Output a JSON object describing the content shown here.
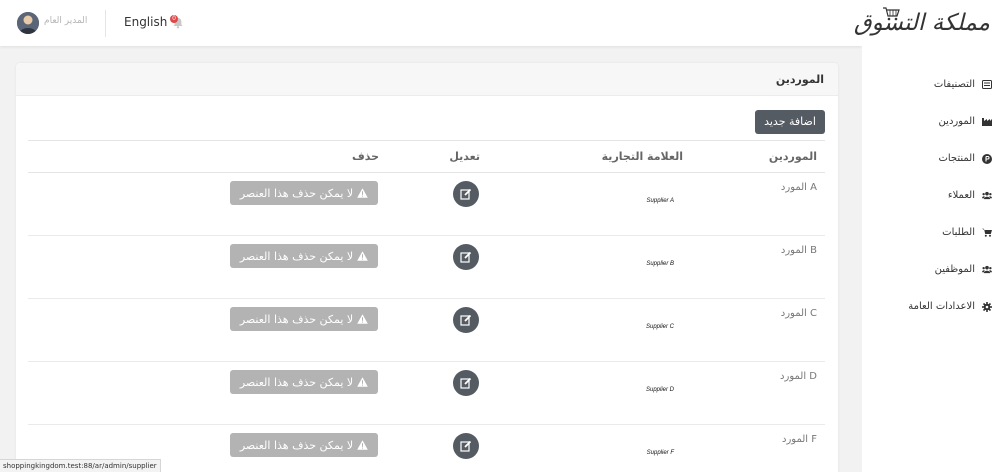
{
  "sidebar": {
    "logo_text": "مملكة التسوق",
    "items": [
      {
        "label": "التصنيفات",
        "icon": "list-alt-icon"
      },
      {
        "label": "الموردين",
        "icon": "industry-icon"
      },
      {
        "label": "المنتجات",
        "icon": "product-hunt-icon"
      },
      {
        "label": "العملاء",
        "icon": "users-icon"
      },
      {
        "label": "الطلبات",
        "icon": "shopping-cart-icon"
      },
      {
        "label": "الموظفين",
        "icon": "users-icon"
      },
      {
        "label": "الاعدادات العامة",
        "icon": "gear-icon"
      }
    ]
  },
  "topbar": {
    "admin_name": "المدير العام",
    "language": "English",
    "notification_count": "0"
  },
  "card": {
    "title": "الموردين",
    "add_button": "اضافة جديد",
    "columns": {
      "supplier": "الموردين",
      "brand": "العلامة التجارية",
      "edit": "تعديل",
      "delete": "حذف"
    },
    "rows": [
      {
        "name": "المورد A",
        "brand": "Supplier A",
        "delete_label": "لا يمكن حذف هذا العنصر"
      },
      {
        "name": "المورد B",
        "brand": "Supplier B",
        "delete_label": "لا يمكن حذف هذا العنصر"
      },
      {
        "name": "المورد C",
        "brand": "Supplier C",
        "delete_label": "لا يمكن حذف هذا العنصر"
      },
      {
        "name": "المورد D",
        "brand": "Supplier D",
        "delete_label": "لا يمكن حذف هذا العنصر"
      },
      {
        "name": "المورد F",
        "brand": "Supplier F",
        "delete_label": "لا يمكن حذف هذا العنصر"
      }
    ]
  },
  "statusbar": {
    "url": "shoppingkingdom.test:88/ar/admin/supplier"
  },
  "colors": {
    "primary_button": "#555b63",
    "disabled_button": "#b3b3b3",
    "badge": "#e04848"
  }
}
